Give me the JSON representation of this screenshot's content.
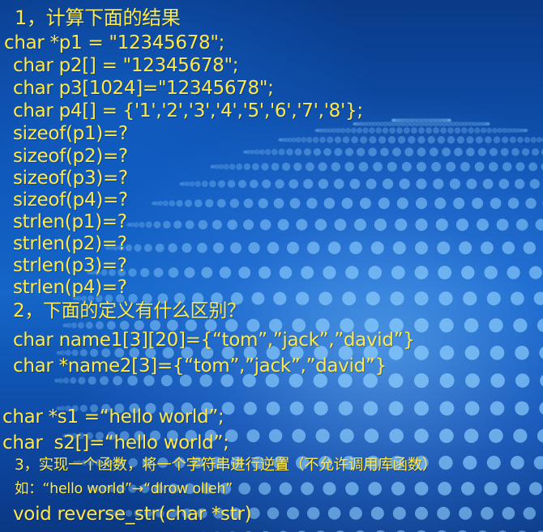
{
  "slide": {
    "lines": [
      "1，计算下面的结果",
      "char *p1 = \"12345678\";",
      "char p2[] = \"12345678\";",
      "char p3[1024]=\"12345678\";",
      "char p4[] = {'1','2','3','4','5','6','7','8'};",
      "sizeof(p1)=?",
      "sizeof(p2)=?",
      "sizeof(p3)=?",
      "sizeof(p4)=?",
      "strlen(p1)=?",
      "strlen(p2)=?",
      "strlen(p3)=?",
      "strlen(p4)=?",
      "2，下面的定义有什么区别？",
      "char name1[3][20]={“tom”,”jack”,”david”}",
      "char *name2[3]={“tom”,”jack”,”david”}",
      "char *s1 =“hello world”;",
      "char  s2[]=“hello world”;",
      "3，实现一个函数，将一个字符串进行逆置（不允许调用库函数）",
      "如：“hello world”→“dlrow olleh”",
      "void reverse_str(char *str)"
    ]
  },
  "colors": {
    "text": "#ffe84a",
    "background": "#0f56b8",
    "dots": "#8fd0ff"
  }
}
